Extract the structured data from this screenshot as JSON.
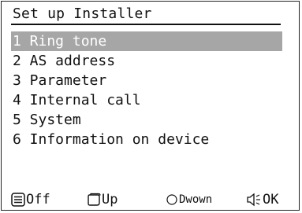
{
  "screen": {
    "title": "Set up Installer"
  },
  "menu": {
    "items": [
      {
        "label": "1 Ring tone",
        "selected": true
      },
      {
        "label": "2 AS address",
        "selected": false
      },
      {
        "label": "3 Parameter",
        "selected": false
      },
      {
        "label": "4 Internal call",
        "selected": false
      },
      {
        "label": "5 System",
        "selected": false
      },
      {
        "label": "6 Information on device",
        "selected": false
      }
    ]
  },
  "softkeys": {
    "off": {
      "label": "Off",
      "icon": "menu-list-icon"
    },
    "up": {
      "label": "Up",
      "icon": "rounded-square-icon"
    },
    "down": {
      "label": "Dwown",
      "icon": "circle-icon"
    },
    "ok": {
      "label": "OK",
      "icon": "speaker-icon"
    }
  },
  "colors": {
    "selection_background": "#a6a6a6",
    "selection_text": "#ffffff",
    "text": "#111111",
    "background": "#ffffff"
  }
}
